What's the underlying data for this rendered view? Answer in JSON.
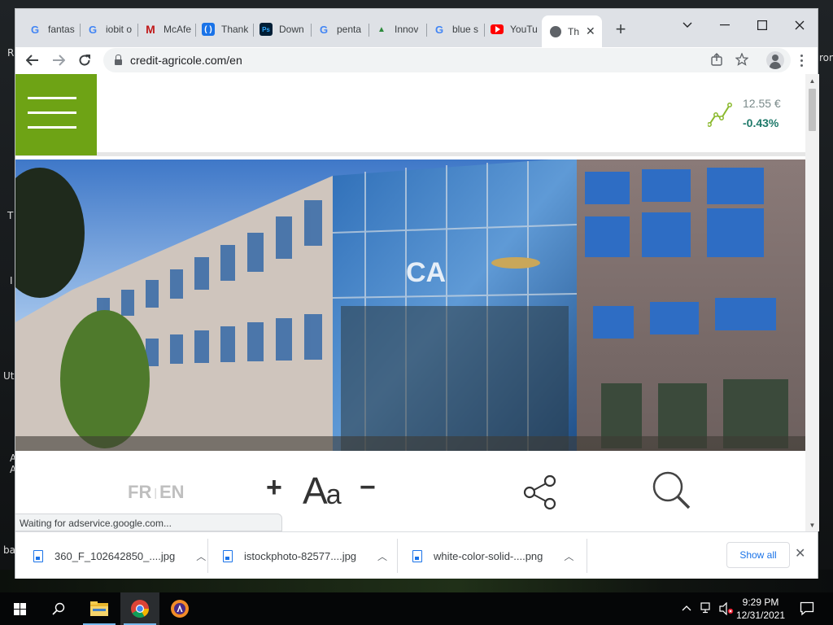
{
  "desktop": {
    "fragments": [
      "R",
      "T",
      "I",
      "Uti",
      "A",
      "A",
      "ba",
      "ron"
    ]
  },
  "browser": {
    "tabs": [
      {
        "label": "fantas",
        "favicon": "google-icon"
      },
      {
        "label": "iobit o",
        "favicon": "google-icon"
      },
      {
        "label": "McAfe",
        "favicon": "mcafee-icon"
      },
      {
        "label": "Thank",
        "favicon": "thanks-icon"
      },
      {
        "label": "Down",
        "favicon": "photoshop-icon"
      },
      {
        "label": "penta",
        "favicon": "google-icon"
      },
      {
        "label": "Innov",
        "favicon": "innovation-icon"
      },
      {
        "label": "blue s",
        "favicon": "google-icon"
      },
      {
        "label": "YouTu",
        "favicon": "youtube-icon"
      },
      {
        "label": "Th",
        "favicon": "globe-icon",
        "active": true
      }
    ],
    "new_tab_symbol": "+",
    "window_controls": {
      "chevron": "⌄",
      "minimize": "—",
      "maximize": "☐",
      "close": "✕"
    },
    "url": "credit-agricole.com/en",
    "status_text": "Waiting for adservice.google.com..."
  },
  "site": {
    "stock": {
      "price": "12.55 €",
      "change": "-0.43%"
    },
    "languages": {
      "fr": "FR",
      "separator": "|",
      "en": "EN"
    },
    "font_tools": {
      "increase": "+",
      "label_big": "A",
      "label_small": "a",
      "decrease": "−"
    },
    "hero_image_alt": "building-photo"
  },
  "downloads": {
    "items": [
      {
        "name": "360_F_102642850_....jpg"
      },
      {
        "name": "istockphoto-82577....jpg"
      },
      {
        "name": "white-color-solid-....png"
      }
    ],
    "show_all_label": "Show all"
  },
  "taskbar": {
    "time": "9:29 PM",
    "date": "12/31/2021"
  },
  "colors": {
    "brand_green": "#6ea315",
    "stock_change": "#1f7a6a",
    "link_blue": "#1a73e8"
  }
}
